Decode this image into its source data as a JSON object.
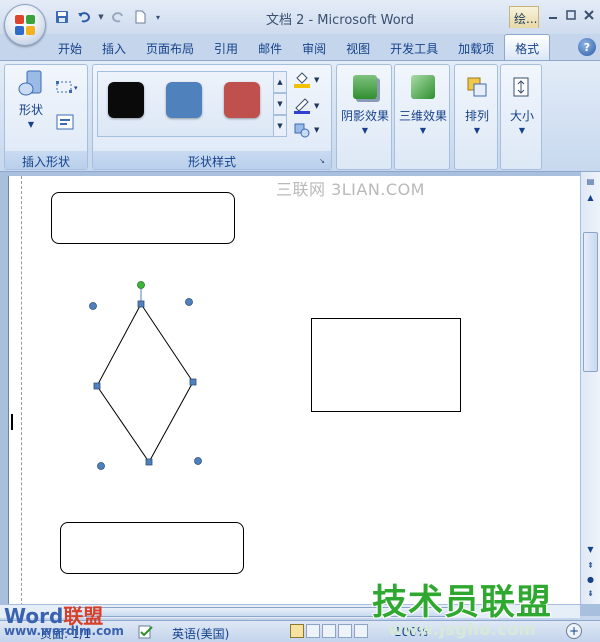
{
  "window": {
    "title": "文档 2 - Microsoft Word",
    "context_tab": "绘..."
  },
  "tabs": [
    {
      "label": "开始",
      "active": false
    },
    {
      "label": "插入",
      "active": false
    },
    {
      "label": "页面布局",
      "active": false
    },
    {
      "label": "引用",
      "active": false
    },
    {
      "label": "邮件",
      "active": false
    },
    {
      "label": "审阅",
      "active": false
    },
    {
      "label": "视图",
      "active": false
    },
    {
      "label": "开发工具",
      "active": false
    },
    {
      "label": "加载项",
      "active": false
    },
    {
      "label": "格式",
      "active": true
    }
  ],
  "help_label": "?",
  "ribbon": {
    "insert_shapes": {
      "label": "插入形状",
      "shapes_button": "形状"
    },
    "shape_styles": {
      "label": "形状样式",
      "swatches": [
        {
          "color": "#0a0a0a"
        },
        {
          "color": "#4f81bd"
        },
        {
          "color": "#c0504d"
        }
      ]
    },
    "shadow_effects": {
      "label": "阴影效果"
    },
    "threed_effects": {
      "label": "三维效果"
    },
    "arrange": {
      "label": "排列"
    },
    "size": {
      "label": "大小"
    }
  },
  "status": {
    "page": "页面: 1/1",
    "language": "英语(美国)",
    "zoom": "100%"
  },
  "watermarks": {
    "top": "三联网 3LIAN.COM",
    "bottom_big": "技术员联盟",
    "bottom_url": "www.jsgho.com",
    "word_brand_a": "Word",
    "word_brand_b": "联盟",
    "word_url": "www.wordlm.com"
  },
  "colors": {
    "selection_handle": "#4f81bd",
    "rotation_handle": "#3cb43c"
  }
}
